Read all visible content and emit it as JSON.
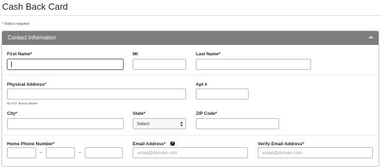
{
  "page": {
    "title": "Cash Back Card",
    "required_note": "* Field is required"
  },
  "section": {
    "title": "Contact Information",
    "collapse_icon": "chevron-up-icon"
  },
  "fields": {
    "first_name": {
      "label": "First Name*",
      "value": "",
      "focused": true
    },
    "mi": {
      "label": "MI",
      "value": ""
    },
    "last_name": {
      "label": "Last Name*",
      "value": ""
    },
    "physical_address": {
      "label": "Physical Address*",
      "value": "",
      "help": "No P.O. Boxes please"
    },
    "apt": {
      "label": "Apt #",
      "value": ""
    },
    "city": {
      "label": "City*",
      "value": ""
    },
    "state": {
      "label": "State*",
      "selected": "Select"
    },
    "zip": {
      "label": "ZIP Code*",
      "value": ""
    },
    "home_phone": {
      "label": "Home Phone Number*",
      "separator": "–"
    },
    "email": {
      "label": "Email Address*",
      "placeholder": "email@domain.com",
      "help_icon": "question-circle-icon"
    },
    "verify_email": {
      "label": "Verify Email Address*",
      "placeholder": "email@domain.com"
    }
  }
}
